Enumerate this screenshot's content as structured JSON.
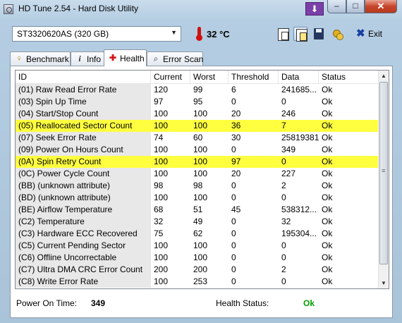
{
  "window": {
    "title": "HD Tune 2.54 - Hard Disk Utility",
    "close_glyph": "✕",
    "min_glyph": "–",
    "max_glyph": "□",
    "download_glyph": "⬇"
  },
  "toolbar": {
    "drive": "ST3320620AS (320 GB)",
    "temperature": "32 °C",
    "exit_label": "Exit",
    "exit_glyph": "✖"
  },
  "tabs": [
    {
      "label": "Benchmark",
      "icon": "bulb-icon",
      "glyph": "💡"
    },
    {
      "label": "Info",
      "icon": "info-icon",
      "glyph": "i"
    },
    {
      "label": "Health",
      "icon": "health-cross-icon",
      "glyph": "✚",
      "active": true
    },
    {
      "label": "Error Scan",
      "icon": "magnifier-icon",
      "glyph": "🔍"
    }
  ],
  "columns": [
    "ID",
    "Current",
    "Worst",
    "Threshold",
    "Data",
    "Status"
  ],
  "rows": [
    {
      "id": "(01) Raw Read Error Rate",
      "current": "120",
      "worst": "99",
      "threshold": "6",
      "data": "241685...",
      "status": "Ok",
      "highlight": false
    },
    {
      "id": "(03) Spin Up Time",
      "current": "97",
      "worst": "95",
      "threshold": "0",
      "data": "0",
      "status": "Ok",
      "highlight": false
    },
    {
      "id": "(04) Start/Stop Count",
      "current": "100",
      "worst": "100",
      "threshold": "20",
      "data": "246",
      "status": "Ok",
      "highlight": false
    },
    {
      "id": "(05) Reallocated Sector Count",
      "current": "100",
      "worst": "100",
      "threshold": "36",
      "data": "7",
      "status": "Ok",
      "highlight": true
    },
    {
      "id": "(07) Seek Error Rate",
      "current": "74",
      "worst": "60",
      "threshold": "30",
      "data": "25819381",
      "status": "Ok",
      "highlight": false
    },
    {
      "id": "(09) Power On Hours Count",
      "current": "100",
      "worst": "100",
      "threshold": "0",
      "data": "349",
      "status": "Ok",
      "highlight": false
    },
    {
      "id": "(0A) Spin Retry Count",
      "current": "100",
      "worst": "100",
      "threshold": "97",
      "data": "0",
      "status": "Ok",
      "highlight": true
    },
    {
      "id": "(0C) Power Cycle Count",
      "current": "100",
      "worst": "100",
      "threshold": "20",
      "data": "227",
      "status": "Ok",
      "highlight": false
    },
    {
      "id": "(BB) (unknown attribute)",
      "current": "98",
      "worst": "98",
      "threshold": "0",
      "data": "2",
      "status": "Ok",
      "highlight": false
    },
    {
      "id": "(BD) (unknown attribute)",
      "current": "100",
      "worst": "100",
      "threshold": "0",
      "data": "0",
      "status": "Ok",
      "highlight": false
    },
    {
      "id": "(BE) Airflow Temperature",
      "current": "68",
      "worst": "51",
      "threshold": "45",
      "data": "538312...",
      "status": "Ok",
      "highlight": false
    },
    {
      "id": "(C2) Temperature",
      "current": "32",
      "worst": "49",
      "threshold": "0",
      "data": "32",
      "status": "Ok",
      "highlight": false
    },
    {
      "id": "(C3) Hardware ECC Recovered",
      "current": "75",
      "worst": "62",
      "threshold": "0",
      "data": "195304...",
      "status": "Ok",
      "highlight": false
    },
    {
      "id": "(C5) Current Pending Sector",
      "current": "100",
      "worst": "100",
      "threshold": "0",
      "data": "0",
      "status": "Ok",
      "highlight": false
    },
    {
      "id": "(C6) Offline Uncorrectable",
      "current": "100",
      "worst": "100",
      "threshold": "0",
      "data": "0",
      "status": "Ok",
      "highlight": false
    },
    {
      "id": "(C7) Ultra DMA CRC Error Count",
      "current": "200",
      "worst": "200",
      "threshold": "0",
      "data": "2",
      "status": "Ok",
      "highlight": false
    },
    {
      "id": "(C8) Write Error Rate",
      "current": "100",
      "worst": "253",
      "threshold": "0",
      "data": "0",
      "status": "Ok",
      "highlight": false
    }
  ],
  "footer": {
    "power_on_label": "Power On Time:",
    "power_on_value": "349",
    "health_label": "Health Status:",
    "health_value": "Ok"
  },
  "colors": {
    "highlight": "#ffff40",
    "health_ok": "#00a000",
    "close": "#c7452a"
  }
}
